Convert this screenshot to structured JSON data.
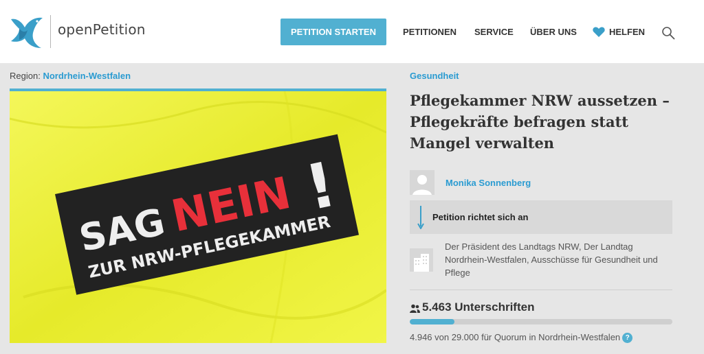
{
  "header": {
    "logo_text": "openPetition",
    "start_button": "PETITION STARTEN",
    "nav": [
      "PETITIONEN",
      "SERVICE",
      "ÜBER UNS"
    ],
    "help_label": "HELFEN"
  },
  "region": {
    "label": "Region:",
    "value": "Nordrhein-Westfalen"
  },
  "banner": {
    "line1_a": "SAG",
    "line1_b": "NEIN",
    "exclaim": "!",
    "line2": "ZUR NRW-PFLEGEKAMMER"
  },
  "petition": {
    "category": "Gesundheit",
    "title": "Pflegekammer NRW aussetzen – Pflegekräfte befragen statt Mangel verwalten",
    "author": "Monika Sonnenberg",
    "addressee_label": "Petition richtet sich an",
    "recipients": "Der Präsident des Landtags NRW, Der Landtag Nordrhein-Westfalen, Ausschüsse für Gesundheit und Pflege",
    "signatures": "5.463 Unterschriften",
    "progress_fraction": 0.17,
    "quorum_text": "4.946 von 29.000 für Quorum in Nordrhein-Westfalen",
    "help": "?"
  },
  "colors": {
    "accent": "#51b0d1",
    "link": "#2a9bd1",
    "banner_yellow": "#eef23a",
    "banner_red": "#e8303a"
  },
  "icons": {
    "logo": "dove-logo-icon",
    "heart": "heart-icon",
    "search": "search-icon",
    "user": "user-avatar-icon",
    "arrow": "arrow-down-icon",
    "building": "building-icon",
    "people": "people-icon"
  }
}
